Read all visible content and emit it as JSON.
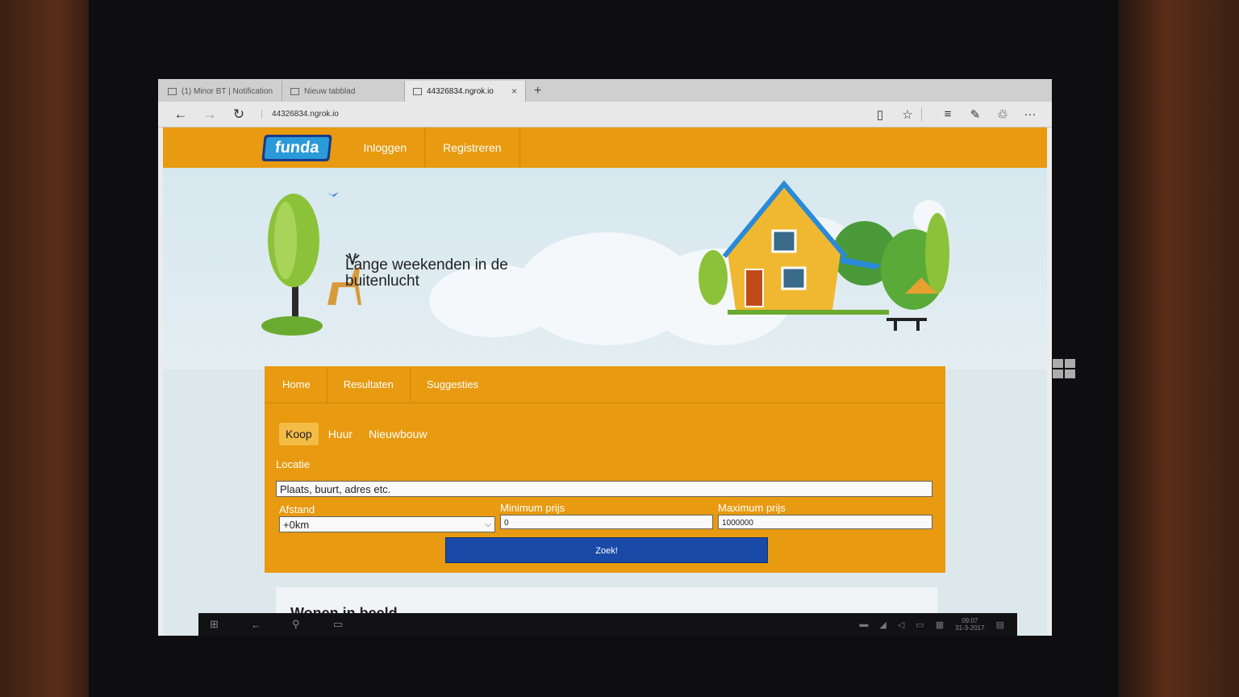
{
  "browser": {
    "tabs": [
      {
        "label": "(1) Minor BT | Notification",
        "active": false
      },
      {
        "label": "Nieuw tabblad",
        "active": false
      },
      {
        "label": "44326834.ngrok.io",
        "active": true
      }
    ],
    "new_tab": "+",
    "close": "×",
    "url": "44326834.ngrok.io",
    "icons": {
      "back": "←",
      "forward": "→",
      "refresh": "↻",
      "reading": "▯",
      "favorite": "☆",
      "hub": "≡",
      "note": "✎",
      "share": "♲",
      "more": "···"
    }
  },
  "site": {
    "logo": "funda",
    "nav": [
      "Inloggen",
      "Registreren"
    ],
    "hero_title": "Lange weekenden in de buitenlucht",
    "subnav": [
      "Home",
      "Resultaten",
      "Suggesties"
    ],
    "type_tabs": [
      {
        "label": "Koop",
        "active": true
      },
      {
        "label": "Huur",
        "active": false
      },
      {
        "label": "Nieuwbouw",
        "active": false
      }
    ],
    "location_label": "Locatie",
    "location_placeholder": "Plaats, buurt, adres etc.",
    "distance_label": "Afstand",
    "distance_value": "+0km",
    "min_label": "Minimum prijs",
    "min_value": "0",
    "max_label": "Maximum prijs",
    "max_value": "1000000",
    "search_button": "Zoek!",
    "below_title": "Wonen in beeld"
  },
  "taskbar": {
    "icons": {
      "start": "⊞",
      "back": "←",
      "search": "⚲",
      "taskview": "▭"
    },
    "time": "09:07",
    "date": "31-3-2017"
  },
  "colors": {
    "brand": "#e89a10",
    "button": "#1a4aa8",
    "logo_blue": "#2a9ad8"
  }
}
